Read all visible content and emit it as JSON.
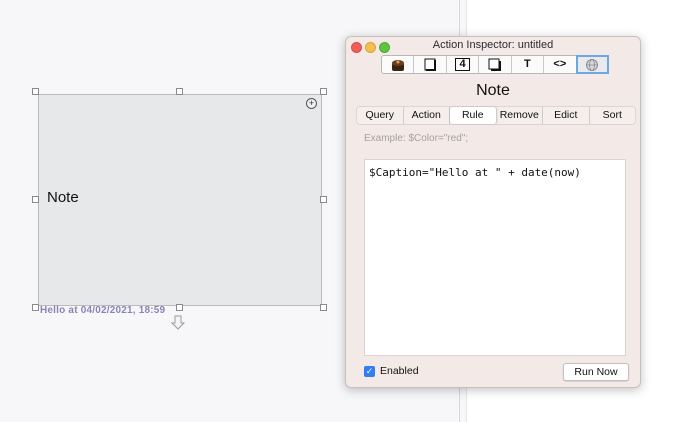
{
  "canvas": {
    "note": {
      "title": "Note"
    },
    "caption": "Hello at 04/02/2021, 18:59"
  },
  "inspector": {
    "window_title": "Action Inspector: untitled",
    "toolbar_icons": [
      "chocolate-icon",
      "square-icon",
      "number-four-icon",
      "shadow-square-icon",
      "text-t-icon",
      "code-brackets-icon",
      "globe-icon"
    ],
    "toolbar_labels": {
      "text": "T",
      "code": "<>",
      "number": "4"
    },
    "title": "Note",
    "tabs": [
      {
        "label": "Query"
      },
      {
        "label": "Action"
      },
      {
        "label": "Rule"
      },
      {
        "label": "Remove"
      },
      {
        "label": "Edict"
      },
      {
        "label": "Sort"
      }
    ],
    "active_tab": "Rule",
    "example_placeholder": "Example: $Color=\"red\";",
    "code": "$Caption=\"Hello at \" + date(now)",
    "enabled_label": "Enabled",
    "enabled_checked": true,
    "run_now_label": "Run Now"
  },
  "colors": {
    "accent": "#2f7ef5",
    "caption": "#8a84b6",
    "window_bg": "#f3e9e7"
  }
}
